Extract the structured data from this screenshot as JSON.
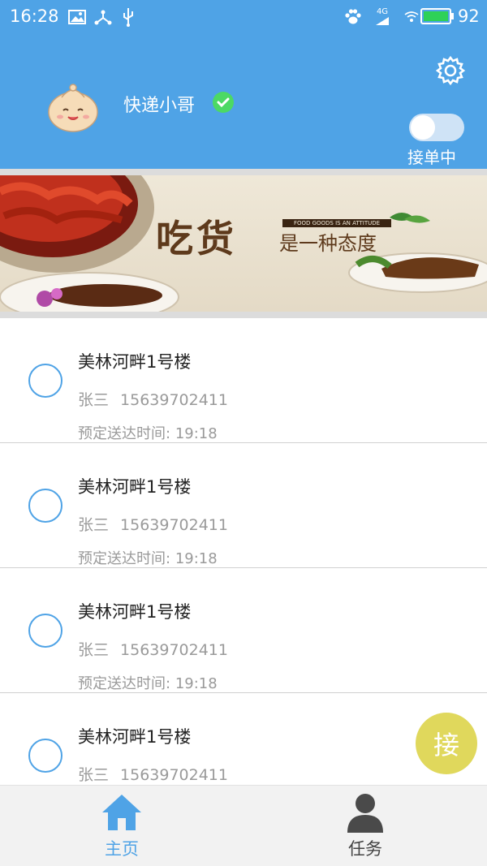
{
  "status_bar": {
    "time": "16:28",
    "battery_percent": "92",
    "network": "4G"
  },
  "header": {
    "username": "快递小哥",
    "toggle_label": "接单中",
    "toggle_on": false,
    "verified": true
  },
  "banner": {
    "title": "吃货",
    "subtitle": "是一种态度",
    "tag": "FOOD GOODS IS AN ATTITUDE"
  },
  "orders": [
    {
      "address": "美林河畔1号楼",
      "name": "张三",
      "phone": "15639702411",
      "eta_label": "预定送达时间:",
      "eta": "19:18"
    },
    {
      "address": "美林河畔1号楼",
      "name": "张三",
      "phone": "15639702411",
      "eta_label": "预定送达时间:",
      "eta": "19:18"
    },
    {
      "address": "美林河畔1号楼",
      "name": "张三",
      "phone": "15639702411",
      "eta_label": "预定送达时间:",
      "eta": "19:18"
    },
    {
      "address": "美林河畔1号楼",
      "name": "张三",
      "phone": "15639702411"
    }
  ],
  "fab": {
    "label": "接"
  },
  "bottom_nav": [
    {
      "label": "主页",
      "icon": "home-icon",
      "active": true
    },
    {
      "label": "任务",
      "icon": "person-icon",
      "active": false
    }
  ],
  "colors": {
    "primary": "#4fa3e6",
    "verified": "#4cd964",
    "fab": "#e0d85c"
  }
}
